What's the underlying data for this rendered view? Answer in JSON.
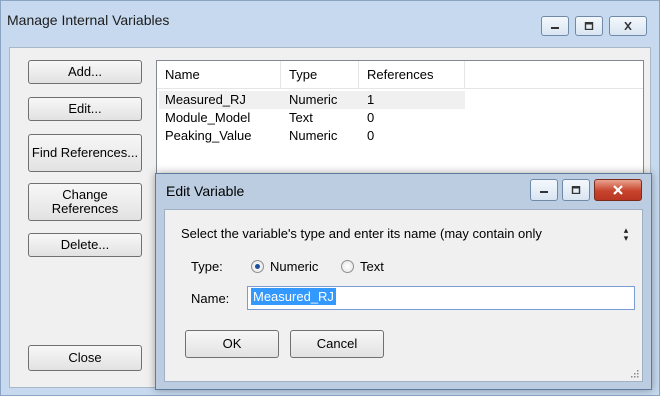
{
  "main_window": {
    "title": "Manage Internal Variables",
    "buttons": {
      "add": "Add...",
      "edit": "Edit...",
      "find_references": "Find References...",
      "change_references": "Change References",
      "delete": "Delete...",
      "close": "Close"
    },
    "list": {
      "columns": [
        "Name",
        "Type",
        "References"
      ],
      "rows": [
        {
          "name": "Measured_RJ",
          "type": "Numeric",
          "references": "1",
          "selected": true
        },
        {
          "name": "Module_Model",
          "type": "Text",
          "references": "0",
          "selected": false
        },
        {
          "name": "Peaking_Value",
          "type": "Numeric",
          "references": "0",
          "selected": false
        }
      ]
    }
  },
  "dialog": {
    "title": "Edit Variable",
    "instruction": "Select the variable's type and enter its name (may contain only",
    "type_label": "Type:",
    "type_options": {
      "numeric": "Numeric",
      "text": "Text"
    },
    "type_selected": "Numeric",
    "name_label": "Name:",
    "name_value": "Measured_RJ",
    "ok": "OK",
    "cancel": "Cancel"
  },
  "icons": {
    "minimize": "minimize-icon",
    "maximize": "maximize-icon",
    "close": "close-icon",
    "resize_grip": "resize-grip-icon",
    "spin": "spin-arrows-icon"
  },
  "colors": {
    "window_frame": "#c6d9ee",
    "dialog_frame": "#bccde1",
    "close_button": "#c7432c",
    "selection": "#3399ff"
  }
}
